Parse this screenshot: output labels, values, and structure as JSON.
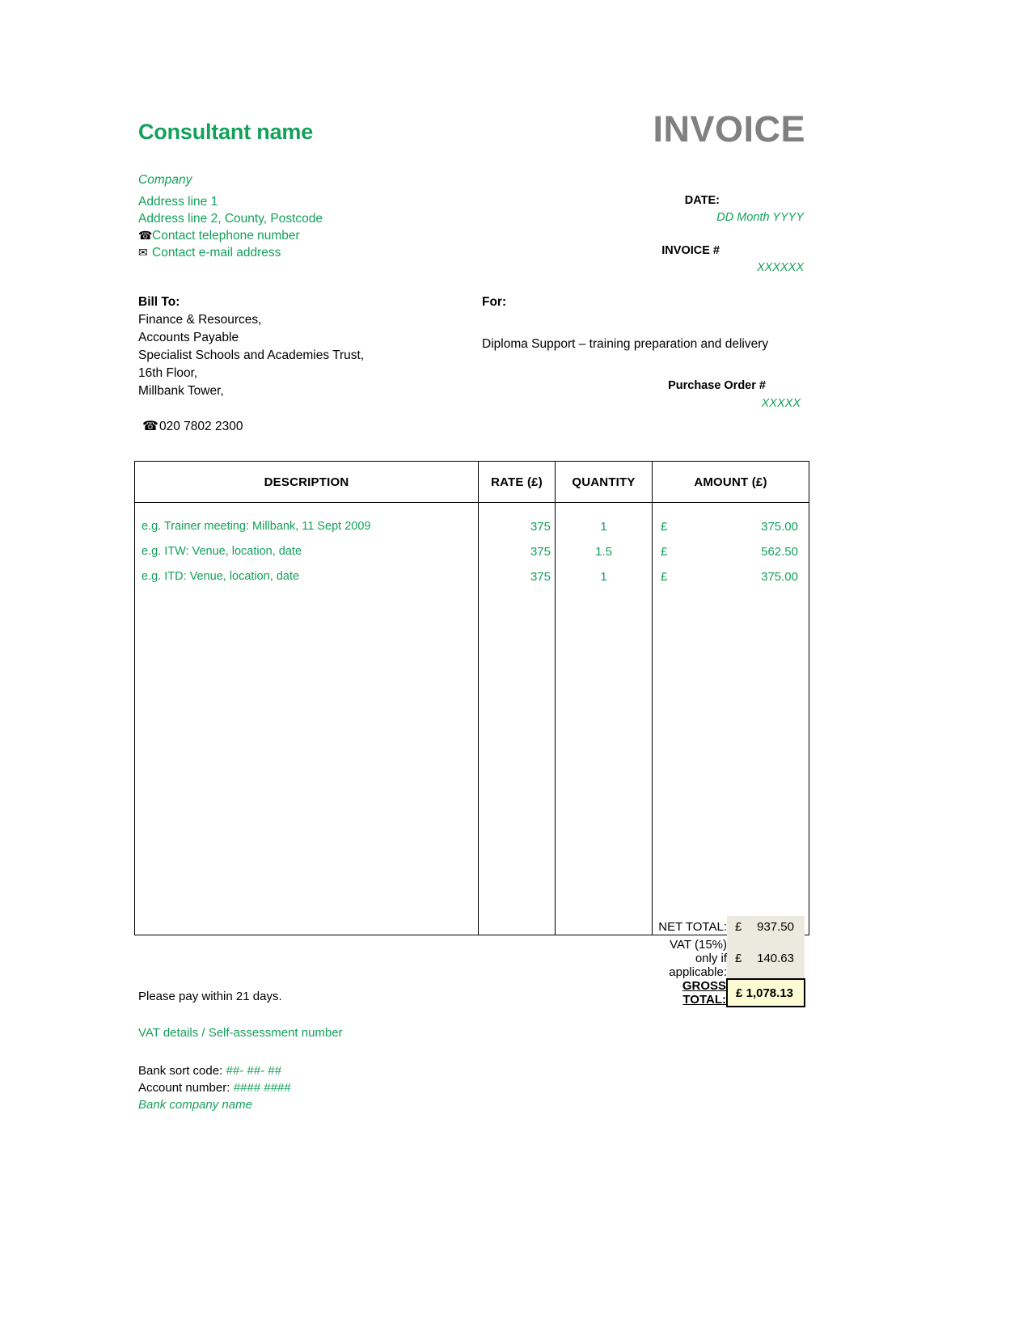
{
  "header": {
    "consultant_name": "Consultant name",
    "invoice_word": "INVOICE"
  },
  "sender": {
    "company": "Company",
    "address_line_1": "Address line 1",
    "address_line_2": "Address line 2, County, Postcode",
    "phone_icon": "telephone-icon",
    "phone": "Contact telephone number",
    "email_icon": "envelope-icon",
    "email": "Contact e-mail address"
  },
  "meta": {
    "date_label": "DATE:",
    "date_value": "DD Month YYYY",
    "invoice_number_label": "INVOICE #",
    "invoice_number_value": "XXXXXX"
  },
  "bill_to": {
    "title": "Bill To:",
    "lines": [
      "Finance & Resources,",
      "Accounts Payable",
      "Specialist Schools and Academies Trust,",
      "16th Floor,",
      "Millbank Tower,"
    ],
    "phone_icon": "telephone-icon",
    "phone": "020 7802 2300"
  },
  "for_section": {
    "title": "For:",
    "description": "Diploma Support – training preparation and delivery",
    "po_label": "Purchase Order #",
    "po_value": "XXXXX"
  },
  "table": {
    "columns": [
      "DESCRIPTION",
      "RATE (£)",
      "QUANTITY",
      "AMOUNT (£)"
    ],
    "currency_symbol": "£",
    "rows": [
      {
        "description": "e.g. Trainer meeting: Millbank, 11 Sept 2009",
        "rate": "375",
        "quantity": "1",
        "amount": "375.00"
      },
      {
        "description": "e.g. ITW: Venue, location, date",
        "rate": "375",
        "quantity": "1.5",
        "amount": "562.50"
      },
      {
        "description": "e.g. ITD: Venue, location, date",
        "rate": "375",
        "quantity": "1",
        "amount": "375.00"
      }
    ]
  },
  "totals": {
    "net_label": "NET TOTAL:",
    "net_currency": "£",
    "net_value": "937.50",
    "vat_label": "VAT (15%) only if applicable:",
    "vat_currency": "£",
    "vat_value": "140.63",
    "gross_label": "GROSS TOTAL:",
    "gross_currency": "£",
    "gross_value": "1,078.13"
  },
  "footer": {
    "payment_terms": "Please pay within 21 days.",
    "vat_details": "VAT details / Self-assessment number",
    "sort_code_label": "Bank sort code: ",
    "sort_code_value": "##- ##- ##",
    "account_label": "Account number: ",
    "account_value": "#### ####",
    "bank_company": "Bank company name"
  },
  "colors": {
    "accent_green": "#13a05b",
    "invoice_gray": "#808080",
    "totals_bg": "#eceade",
    "gross_bg": "#fdfbd4"
  }
}
